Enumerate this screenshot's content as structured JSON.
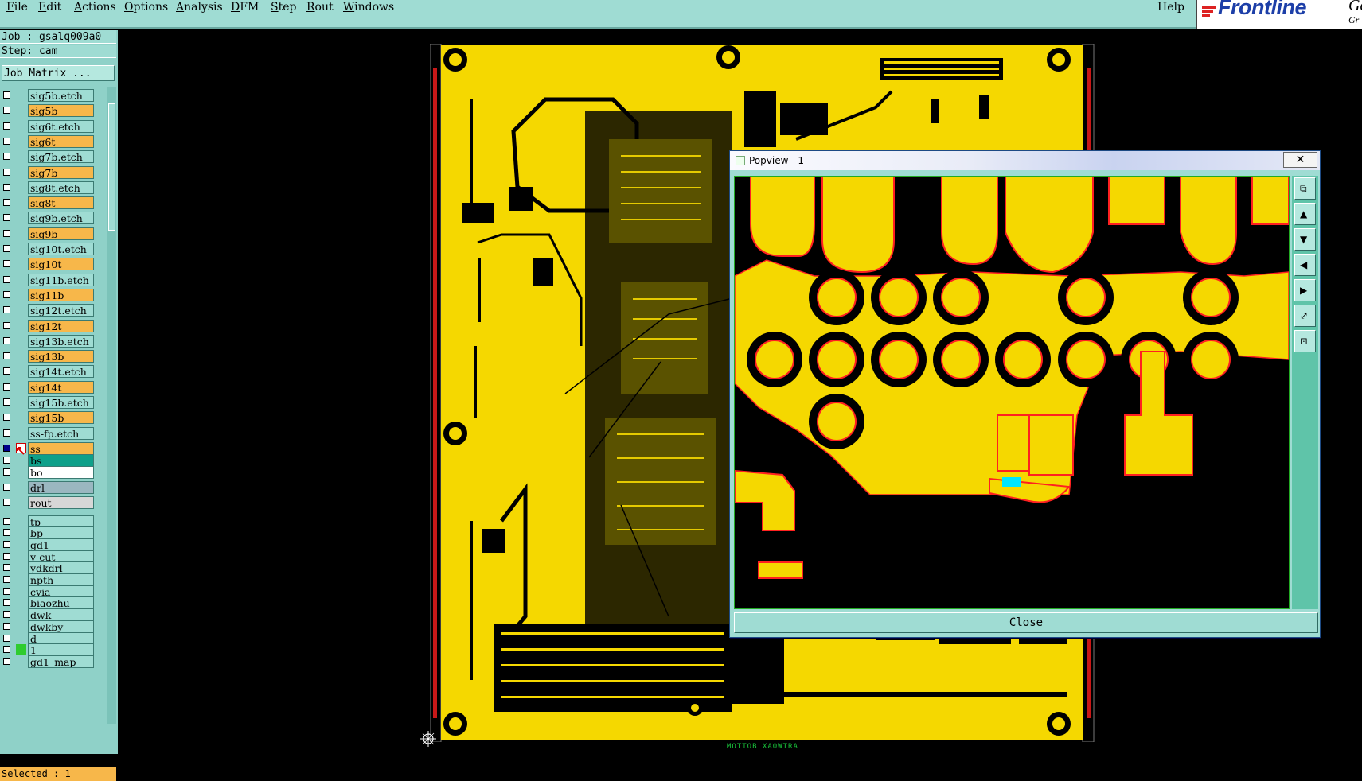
{
  "menubar": {
    "items": [
      "File",
      "Edit",
      "Actions",
      "Options",
      "Analysis",
      "DFM",
      "Step",
      "Rout",
      "Windows"
    ],
    "help": "Help",
    "logo": "Frontline",
    "logo_suffix": "Ge",
    "logo_suffix2": "Gr"
  },
  "job_info": {
    "job_line": "Job : gsalq009a0",
    "step_line": "Step: cam",
    "matrix_button": "Job Matrix ..."
  },
  "layers": [
    {
      "name": "sig5b.etch",
      "color": "#9fdcd3",
      "selected": false,
      "marker": ""
    },
    {
      "name": "sig5b",
      "color": "#f7b74a",
      "selected": false,
      "marker": ""
    },
    {
      "name": "sig6t.etch",
      "color": "#9fdcd3",
      "selected": false,
      "marker": ""
    },
    {
      "name": "sig6t",
      "color": "#f7b74a",
      "selected": false,
      "marker": ""
    },
    {
      "name": "sig7b.etch",
      "color": "#9fdcd3",
      "selected": false,
      "marker": ""
    },
    {
      "name": "sig7b",
      "color": "#f7b74a",
      "selected": false,
      "marker": ""
    },
    {
      "name": "sig8t.etch",
      "color": "#9fdcd3",
      "selected": false,
      "marker": ""
    },
    {
      "name": "sig8t",
      "color": "#f7b74a",
      "selected": false,
      "marker": ""
    },
    {
      "name": "sig9b.etch",
      "color": "#9fdcd3",
      "selected": false,
      "marker": ""
    },
    {
      "name": "sig9b",
      "color": "#f7b74a",
      "selected": false,
      "marker": ""
    },
    {
      "name": "sig10t.etch",
      "color": "#9fdcd3",
      "selected": false,
      "marker": ""
    },
    {
      "name": "sig10t",
      "color": "#f7b74a",
      "selected": false,
      "marker": ""
    },
    {
      "name": "sig11b.etch",
      "color": "#9fdcd3",
      "selected": false,
      "marker": ""
    },
    {
      "name": "sig11b",
      "color": "#f7b74a",
      "selected": false,
      "marker": ""
    },
    {
      "name": "sig12t.etch",
      "color": "#9fdcd3",
      "selected": false,
      "marker": ""
    },
    {
      "name": "sig12t",
      "color": "#f7b74a",
      "selected": false,
      "marker": ""
    },
    {
      "name": "sig13b.etch",
      "color": "#9fdcd3",
      "selected": false,
      "marker": ""
    },
    {
      "name": "sig13b",
      "color": "#f7b74a",
      "selected": false,
      "marker": ""
    },
    {
      "name": "sig14t.etch",
      "color": "#9fdcd3",
      "selected": false,
      "marker": ""
    },
    {
      "name": "sig14t",
      "color": "#f7b74a",
      "selected": false,
      "marker": ""
    },
    {
      "name": "sig15b.etch",
      "color": "#9fdcd3",
      "selected": false,
      "marker": ""
    },
    {
      "name": "sig15b",
      "color": "#f7b74a",
      "selected": false,
      "marker": ""
    },
    {
      "name": "ss-fp.etch",
      "color": "#9fdcd3",
      "selected": false,
      "marker": ""
    },
    {
      "name": "ss",
      "color": "#f7b74a",
      "selected": true,
      "marker": "work"
    },
    {
      "name": "bs",
      "color": "#0fa08a",
      "selected": false,
      "marker": ""
    },
    {
      "name": "bo",
      "color": "#ffffff",
      "selected": false,
      "marker": ""
    },
    {
      "name": "drl",
      "color": "#9ab7c0",
      "selected": false,
      "marker": ""
    },
    {
      "name": "rout",
      "color": "#d7d7d7",
      "selected": false,
      "marker": ""
    },
    {
      "name": "tp",
      "color": "#9fdcd3",
      "selected": false,
      "marker": ""
    },
    {
      "name": "bp",
      "color": "#9fdcd3",
      "selected": false,
      "marker": ""
    },
    {
      "name": "gd1",
      "color": "#9fdcd3",
      "selected": false,
      "marker": ""
    },
    {
      "name": "v-cut",
      "color": "#9fdcd3",
      "selected": false,
      "marker": ""
    },
    {
      "name": "ydkdrl",
      "color": "#9fdcd3",
      "selected": false,
      "marker": ""
    },
    {
      "name": "npth",
      "color": "#9fdcd3",
      "selected": false,
      "marker": ""
    },
    {
      "name": "cvia",
      "color": "#9fdcd3",
      "selected": false,
      "marker": ""
    },
    {
      "name": "biaozhu",
      "color": "#9fdcd3",
      "selected": false,
      "marker": ""
    },
    {
      "name": "dwk",
      "color": "#9fdcd3",
      "selected": false,
      "marker": ""
    },
    {
      "name": "dwkby",
      "color": "#9fdcd3",
      "selected": false,
      "marker": ""
    },
    {
      "name": "d",
      "color": "#9fdcd3",
      "selected": false,
      "marker": ""
    },
    {
      "name": "1",
      "color": "#9fdcd3",
      "selected": false,
      "marker": "green"
    },
    {
      "name": "gd1_map",
      "color": "#9fdcd3",
      "selected": false,
      "marker": ""
    }
  ],
  "status": {
    "selected": "Selected : 1"
  },
  "board": {
    "bottom_text": "MOTTOB XAOWTRA"
  },
  "popview": {
    "title": "Popview - 1",
    "close_x": "✕",
    "close_button": "Close",
    "tools": [
      "zoom-window-icon",
      "pan-up-icon",
      "pan-down-icon",
      "pan-left-icon",
      "pan-right-icon",
      "zoom-fit-icon",
      "zoom-out-icon"
    ]
  },
  "colors": {
    "copper": "#f5d800",
    "background": "#000000",
    "panel": "#9fdcd3",
    "highlight": "#00e5ff",
    "edge_red": "#ff2020"
  }
}
